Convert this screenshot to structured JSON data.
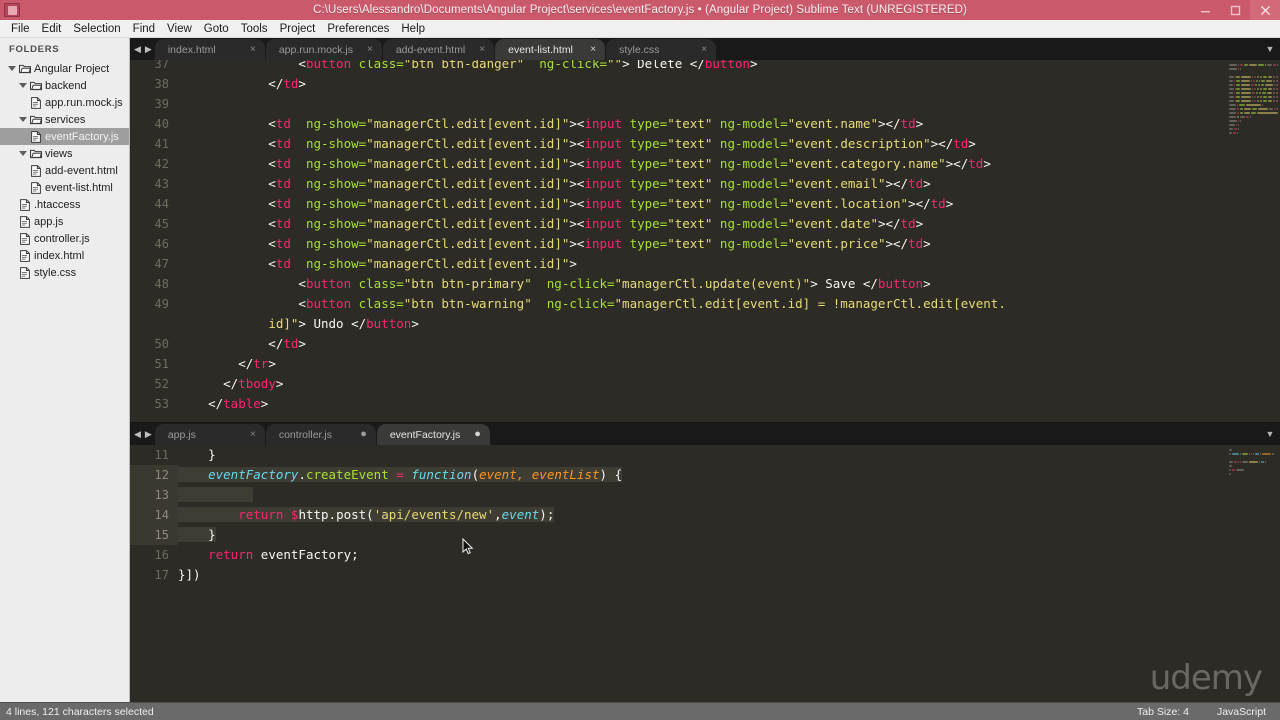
{
  "window": {
    "title": "C:\\Users\\Alessandro\\Documents\\Angular Project\\services\\eventFactory.js • (Angular Project)    Sublime Text (UNREGISTERED)",
    "minimize_label": "–",
    "maximize_label": "▣",
    "close_label": "✕",
    "titlebar_color": "#c9596b"
  },
  "menubar": {
    "items": [
      {
        "label": "File"
      },
      {
        "label": "Edit"
      },
      {
        "label": "Selection"
      },
      {
        "label": "Find"
      },
      {
        "label": "View"
      },
      {
        "label": "Goto"
      },
      {
        "label": "Tools"
      },
      {
        "label": "Project"
      },
      {
        "label": "Preferences"
      },
      {
        "label": "Help"
      }
    ]
  },
  "sidebar": {
    "header": "FOLDERS",
    "items": [
      {
        "label": "Angular Project",
        "type": "folder",
        "depth": 0,
        "open": true,
        "active": false
      },
      {
        "label": "backend",
        "type": "folder",
        "depth": 1,
        "open": true,
        "active": false
      },
      {
        "label": "app.run.mock.js",
        "type": "file",
        "depth": 2,
        "active": false
      },
      {
        "label": "services",
        "type": "folder",
        "depth": 1,
        "open": true,
        "active": false
      },
      {
        "label": "eventFactory.js",
        "type": "file",
        "depth": 2,
        "active": true
      },
      {
        "label": "views",
        "type": "folder",
        "depth": 1,
        "open": true,
        "active": false
      },
      {
        "label": "add-event.html",
        "type": "file",
        "depth": 2,
        "active": false
      },
      {
        "label": "event-list.html",
        "type": "file",
        "depth": 2,
        "active": false
      },
      {
        "label": ".htaccess",
        "type": "file",
        "depth": 1,
        "active": false
      },
      {
        "label": "app.js",
        "type": "file",
        "depth": 1,
        "active": false
      },
      {
        "label": "controller.js",
        "type": "file",
        "depth": 1,
        "active": false
      },
      {
        "label": "index.html",
        "type": "file",
        "depth": 1,
        "active": false
      },
      {
        "label": "style.css",
        "type": "file",
        "depth": 1,
        "active": false
      }
    ]
  },
  "top_pane": {
    "tabs": [
      {
        "label": "index.html",
        "active": false,
        "dirty": false
      },
      {
        "label": "app.run.mock.js",
        "active": false,
        "dirty": false
      },
      {
        "label": "add-event.html",
        "active": false,
        "dirty": false
      },
      {
        "label": "event-list.html",
        "active": true,
        "dirty": false
      },
      {
        "label": "style.css",
        "active": false,
        "dirty": false
      }
    ],
    "close_glyph": "×",
    "dirty_glyph": "●",
    "scroll_left_glyph": "◀",
    "scroll_right_glyph": "▶",
    "menu_glyph": "▼",
    "lines": [
      {
        "n": 37,
        "clipped": true,
        "tokens": [
          {
            "t": "                ",
            "c": "t-white"
          },
          {
            "t": "<",
            "c": "t-white"
          },
          {
            "t": "button",
            "c": "t-tag"
          },
          {
            "t": " class=",
            "c": "t-attr"
          },
          {
            "t": "\"btn btn-danger\"",
            "c": "t-str"
          },
          {
            "t": "  ng-click=",
            "c": "t-attr"
          },
          {
            "t": "\"\"",
            "c": "t-str"
          },
          {
            "t": "> Delete </",
            "c": "t-white"
          },
          {
            "t": "button",
            "c": "t-tag"
          },
          {
            "t": ">",
            "c": "t-white"
          }
        ]
      },
      {
        "n": 38,
        "tokens": [
          {
            "t": "            </",
            "c": "t-white"
          },
          {
            "t": "td",
            "c": "t-tag"
          },
          {
            "t": ">",
            "c": "t-white"
          }
        ]
      },
      {
        "n": 39,
        "tokens": []
      },
      {
        "n": 40,
        "tokens": [
          {
            "t": "            <",
            "c": "t-white"
          },
          {
            "t": "td",
            "c": "t-tag"
          },
          {
            "t": "  ng-show=",
            "c": "t-attr"
          },
          {
            "t": "\"managerCtl.edit[event.id]\"",
            "c": "t-str"
          },
          {
            "t": "><",
            "c": "t-white"
          },
          {
            "t": "input",
            "c": "t-tag"
          },
          {
            "t": " type=",
            "c": "t-attr"
          },
          {
            "t": "\"text\"",
            "c": "t-str"
          },
          {
            "t": " ng-model=",
            "c": "t-attr"
          },
          {
            "t": "\"event.name\"",
            "c": "t-str"
          },
          {
            "t": "></",
            "c": "t-white"
          },
          {
            "t": "td",
            "c": "t-tag"
          },
          {
            "t": ">",
            "c": "t-white"
          }
        ]
      },
      {
        "n": 41,
        "tokens": [
          {
            "t": "            <",
            "c": "t-white"
          },
          {
            "t": "td",
            "c": "t-tag"
          },
          {
            "t": "  ng-show=",
            "c": "t-attr"
          },
          {
            "t": "\"managerCtl.edit[event.id]\"",
            "c": "t-str"
          },
          {
            "t": "><",
            "c": "t-white"
          },
          {
            "t": "input",
            "c": "t-tag"
          },
          {
            "t": " type=",
            "c": "t-attr"
          },
          {
            "t": "\"text\"",
            "c": "t-str"
          },
          {
            "t": " ng-model=",
            "c": "t-attr"
          },
          {
            "t": "\"event.description\"",
            "c": "t-str"
          },
          {
            "t": "></",
            "c": "t-white"
          },
          {
            "t": "td",
            "c": "t-tag"
          },
          {
            "t": ">",
            "c": "t-white"
          }
        ]
      },
      {
        "n": 42,
        "tokens": [
          {
            "t": "            <",
            "c": "t-white"
          },
          {
            "t": "td",
            "c": "t-tag"
          },
          {
            "t": "  ng-show=",
            "c": "t-attr"
          },
          {
            "t": "\"managerCtl.edit[event.id]\"",
            "c": "t-str"
          },
          {
            "t": "><",
            "c": "t-white"
          },
          {
            "t": "input",
            "c": "t-tag"
          },
          {
            "t": " type=",
            "c": "t-attr"
          },
          {
            "t": "\"text\"",
            "c": "t-str"
          },
          {
            "t": " ng-model=",
            "c": "t-attr"
          },
          {
            "t": "\"event.category.name\"",
            "c": "t-str"
          },
          {
            "t": "></",
            "c": "t-white"
          },
          {
            "t": "td",
            "c": "t-tag"
          },
          {
            "t": ">",
            "c": "t-white"
          }
        ]
      },
      {
        "n": 43,
        "tokens": [
          {
            "t": "            <",
            "c": "t-white"
          },
          {
            "t": "td",
            "c": "t-tag"
          },
          {
            "t": "  ng-show=",
            "c": "t-attr"
          },
          {
            "t": "\"managerCtl.edit[event.id]\"",
            "c": "t-str"
          },
          {
            "t": "><",
            "c": "t-white"
          },
          {
            "t": "input",
            "c": "t-tag"
          },
          {
            "t": " type=",
            "c": "t-attr"
          },
          {
            "t": "\"text\"",
            "c": "t-str"
          },
          {
            "t": " ng-model=",
            "c": "t-attr"
          },
          {
            "t": "\"event.email\"",
            "c": "t-str"
          },
          {
            "t": "></",
            "c": "t-white"
          },
          {
            "t": "td",
            "c": "t-tag"
          },
          {
            "t": ">",
            "c": "t-white"
          }
        ]
      },
      {
        "n": 44,
        "tokens": [
          {
            "t": "            <",
            "c": "t-white"
          },
          {
            "t": "td",
            "c": "t-tag"
          },
          {
            "t": "  ng-show=",
            "c": "t-attr"
          },
          {
            "t": "\"managerCtl.edit[event.id]\"",
            "c": "t-str"
          },
          {
            "t": "><",
            "c": "t-white"
          },
          {
            "t": "input",
            "c": "t-tag"
          },
          {
            "t": " type=",
            "c": "t-attr"
          },
          {
            "t": "\"text\"",
            "c": "t-str"
          },
          {
            "t": " ng-model=",
            "c": "t-attr"
          },
          {
            "t": "\"event.location\"",
            "c": "t-str"
          },
          {
            "t": "></",
            "c": "t-white"
          },
          {
            "t": "td",
            "c": "t-tag"
          },
          {
            "t": ">",
            "c": "t-white"
          }
        ]
      },
      {
        "n": 45,
        "tokens": [
          {
            "t": "            <",
            "c": "t-white"
          },
          {
            "t": "td",
            "c": "t-tag"
          },
          {
            "t": "  ng-show=",
            "c": "t-attr"
          },
          {
            "t": "\"managerCtl.edit[event.id]\"",
            "c": "t-str"
          },
          {
            "t": "><",
            "c": "t-white"
          },
          {
            "t": "input",
            "c": "t-tag"
          },
          {
            "t": " type=",
            "c": "t-attr"
          },
          {
            "t": "\"text\"",
            "c": "t-str"
          },
          {
            "t": " ng-model=",
            "c": "t-attr"
          },
          {
            "t": "\"event.date\"",
            "c": "t-str"
          },
          {
            "t": "></",
            "c": "t-white"
          },
          {
            "t": "td",
            "c": "t-tag"
          },
          {
            "t": ">",
            "c": "t-white"
          }
        ]
      },
      {
        "n": 46,
        "tokens": [
          {
            "t": "            <",
            "c": "t-white"
          },
          {
            "t": "td",
            "c": "t-tag"
          },
          {
            "t": "  ng-show=",
            "c": "t-attr"
          },
          {
            "t": "\"managerCtl.edit[event.id]\"",
            "c": "t-str"
          },
          {
            "t": "><",
            "c": "t-white"
          },
          {
            "t": "input",
            "c": "t-tag"
          },
          {
            "t": " type=",
            "c": "t-attr"
          },
          {
            "t": "\"text\"",
            "c": "t-str"
          },
          {
            "t": " ng-model=",
            "c": "t-attr"
          },
          {
            "t": "\"event.price\"",
            "c": "t-str"
          },
          {
            "t": "></",
            "c": "t-white"
          },
          {
            "t": "td",
            "c": "t-tag"
          },
          {
            "t": ">",
            "c": "t-white"
          }
        ]
      },
      {
        "n": 47,
        "tokens": [
          {
            "t": "            <",
            "c": "t-white"
          },
          {
            "t": "td",
            "c": "t-tag"
          },
          {
            "t": "  ng-show=",
            "c": "t-attr"
          },
          {
            "t": "\"managerCtl.edit[event.id]\"",
            "c": "t-str"
          },
          {
            "t": ">",
            "c": "t-white"
          }
        ]
      },
      {
        "n": 48,
        "tokens": [
          {
            "t": "                <",
            "c": "t-white"
          },
          {
            "t": "button",
            "c": "t-tag"
          },
          {
            "t": " class=",
            "c": "t-attr"
          },
          {
            "t": "\"btn btn-primary\"",
            "c": "t-str"
          },
          {
            "t": "  ng-click=",
            "c": "t-attr"
          },
          {
            "t": "\"managerCtl.update(event)\"",
            "c": "t-str"
          },
          {
            "t": "> Save </",
            "c": "t-white"
          },
          {
            "t": "button",
            "c": "t-tag"
          },
          {
            "t": ">",
            "c": "t-white"
          }
        ]
      },
      {
        "n": 49,
        "tokens": [
          {
            "t": "                <",
            "c": "t-white"
          },
          {
            "t": "button",
            "c": "t-tag"
          },
          {
            "t": " class=",
            "c": "t-attr"
          },
          {
            "t": "\"btn btn-warning\"",
            "c": "t-str"
          },
          {
            "t": "  ng-click=",
            "c": "t-attr"
          },
          {
            "t": "\"managerCtl.edit[event.id] = !managerCtl.edit[event.",
            "c": "t-str"
          }
        ]
      },
      {
        "n": null,
        "wrap": true,
        "tokens": [
          {
            "t": "            ",
            "c": "t-white"
          },
          {
            "t": "id]\"",
            "c": "t-str"
          },
          {
            "t": "> Undo </",
            "c": "t-white"
          },
          {
            "t": "button",
            "c": "t-tag"
          },
          {
            "t": ">",
            "c": "t-white"
          }
        ]
      },
      {
        "n": 50,
        "tokens": [
          {
            "t": "            </",
            "c": "t-white"
          },
          {
            "t": "td",
            "c": "t-tag"
          },
          {
            "t": ">",
            "c": "t-white"
          }
        ]
      },
      {
        "n": 51,
        "tokens": [
          {
            "t": "        </",
            "c": "t-white"
          },
          {
            "t": "tr",
            "c": "t-tag"
          },
          {
            "t": ">",
            "c": "t-white"
          }
        ]
      },
      {
        "n": 52,
        "tokens": [
          {
            "t": "      </",
            "c": "t-white"
          },
          {
            "t": "tbody",
            "c": "t-tag"
          },
          {
            "t": ">",
            "c": "t-white"
          }
        ]
      },
      {
        "n": 53,
        "tokens": [
          {
            "t": "    </",
            "c": "t-white"
          },
          {
            "t": "table",
            "c": "t-tag"
          },
          {
            "t": ">",
            "c": "t-white"
          }
        ]
      }
    ]
  },
  "bottom_pane": {
    "tabs": [
      {
        "label": "app.js",
        "active": false,
        "dirty": false
      },
      {
        "label": "controller.js",
        "active": false,
        "dirty": true
      },
      {
        "label": "eventFactory.js",
        "active": true,
        "dirty": true
      }
    ],
    "lines": [
      {
        "n": 11,
        "sel": false,
        "tokens": [
          {
            "t": "    }",
            "c": "t-white"
          }
        ]
      },
      {
        "n": 12,
        "sel": true,
        "tokens": [
          {
            "t": "    ",
            "c": "t-white"
          },
          {
            "t": "eventFactory",
            "c": "t-italic"
          },
          {
            "t": ".",
            "c": "t-white"
          },
          {
            "t": "createEvent",
            "c": "t-fn"
          },
          {
            "t": " ",
            "c": "t-white"
          },
          {
            "t": "=",
            "c": "t-kw"
          },
          {
            "t": " ",
            "c": "t-white"
          },
          {
            "t": "function",
            "c": "t-italic"
          },
          {
            "t": "(",
            "c": "t-white"
          },
          {
            "t": "event, eventList",
            "c": "t-param"
          },
          {
            "t": ") {",
            "c": "t-white"
          }
        ]
      },
      {
        "n": 13,
        "sel": true,
        "tokens": []
      },
      {
        "n": 14,
        "sel": true,
        "tokens": [
          {
            "t": "        ",
            "c": "t-white"
          },
          {
            "t": "return",
            "c": "t-kw"
          },
          {
            "t": " ",
            "c": "t-white"
          },
          {
            "t": "$",
            "c": "t-kw"
          },
          {
            "t": "http.post(",
            "c": "t-white"
          },
          {
            "t": "'api/events/new'",
            "c": "t-str"
          },
          {
            "t": ",",
            "c": "t-white"
          },
          {
            "t": "event",
            "c": "t-italic"
          },
          {
            "t": ");",
            "c": "t-white"
          }
        ]
      },
      {
        "n": 15,
        "sel": true,
        "tokens": [
          {
            "t": "    }",
            "c": "t-white"
          }
        ]
      },
      {
        "n": 16,
        "sel": false,
        "tokens": [
          {
            "t": "    ",
            "c": "t-white"
          },
          {
            "t": "return",
            "c": "t-kw"
          },
          {
            "t": " eventFactory;",
            "c": "t-white"
          }
        ]
      },
      {
        "n": 17,
        "sel": false,
        "tokens": [
          {
            "t": "}])",
            "c": "t-white"
          }
        ]
      }
    ]
  },
  "statusbar": {
    "selection": "4 lines, 121 characters selected",
    "tab_size": "Tab Size: 4",
    "syntax": "JavaScript"
  },
  "watermark": "udemy"
}
